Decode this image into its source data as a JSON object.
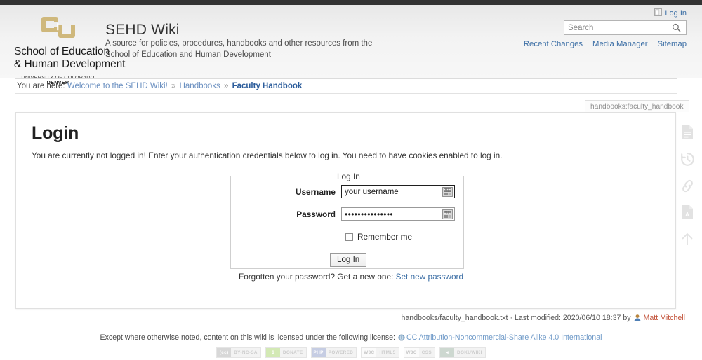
{
  "topbar": {
    "present": true,
    "color": "#333333"
  },
  "header": {
    "logo": {
      "mark_alt": "cu-monogram-icon",
      "name_line1": "School of Education",
      "name_line2": "& Human Development",
      "sub_prefix": "UNIVERSITY OF COLORADO ",
      "sub_bold": "DENVER",
      "gold": "#CFB87C"
    },
    "site_title": "SEHD Wiki",
    "tagline_line1": "A source for policies, procedures, handbooks and other resources from the",
    "tagline_line2": "School of Education and Human Development",
    "login_link": "Log In",
    "login_icon": "login-icon"
  },
  "search": {
    "placeholder": "Search",
    "value": "",
    "icon": "search-icon"
  },
  "toollinks": [
    {
      "label": "Recent Changes",
      "name": "recent-changes"
    },
    {
      "label": "Media Manager",
      "name": "media-manager"
    },
    {
      "label": "Sitemap",
      "name": "sitemap"
    }
  ],
  "breadcrumb": {
    "prefix": "You are here:",
    "items": [
      {
        "label": "Welcome to the SEHD Wiki!",
        "current": false
      },
      {
        "label": "Handbooks",
        "current": false
      },
      {
        "label": "Faculty Handbook",
        "current": true
      }
    ],
    "separator": "»"
  },
  "page_id_tab": "handbooks:faculty_handbook",
  "main": {
    "title": "Login",
    "intro": "You are currently not logged in! Enter your authentication credentials below to log in. You need to have cookies enabled to log in.",
    "form": {
      "legend": "Log In",
      "username_label": "Username",
      "username_value": "your username",
      "username_placeholder": "",
      "password_label": "Password",
      "password_value": "•••••••••••••••",
      "remember_label": "Remember me",
      "remember_checked": false,
      "submit_label": "Log In",
      "autofill_icon": "autofill-keyboard-icon"
    },
    "forgot_prefix": "Forgotten your password? Get a new one:",
    "forgot_link": "Set new password"
  },
  "icon_rail": [
    {
      "name": "show-page-source-icon",
      "glyph": "document"
    },
    {
      "name": "old-revisions-icon",
      "glyph": "history"
    },
    {
      "name": "backlinks-icon",
      "glyph": "link"
    },
    {
      "name": "export-pdf-icon",
      "glyph": "pdf"
    },
    {
      "name": "back-to-top-icon",
      "glyph": "arrow-up"
    }
  ],
  "docinfo": {
    "path": "handbooks/faculty_handbook.txt",
    "separator": "·",
    "modified_label": "Last modified: 2020/06/10 18:37 by",
    "user": "Matt Mitchell",
    "user_icon": "user-avatar-icon"
  },
  "license": {
    "text": "Except where otherwise noted, content on this wiki is licensed under the following license:",
    "icon": "globe-icon",
    "link": "CC Attribution-Noncommercial-Share Alike 4.0 International"
  },
  "badges": [
    {
      "name": "cc-badge",
      "left": "(cc)",
      "right": "BY-NC-SA",
      "left_bg": "#9a9a9a"
    },
    {
      "name": "donate-badge",
      "left": "$",
      "right": "DONATE",
      "left_bg": "#8dc63f"
    },
    {
      "name": "php-badge",
      "left": "PHP",
      "right": "POWERED",
      "left_bg": "#6c7eb7"
    },
    {
      "name": "html5-badge",
      "left": "W3C",
      "right": "HTML5",
      "left_bg": "#f5f5f5"
    },
    {
      "name": "css-badge",
      "left": "W3C",
      "right": "CSS",
      "left_bg": "#f5f5f5"
    },
    {
      "name": "dokuwiki-badge",
      "left": "◄",
      "right": "DOKUWIKI",
      "left_bg": "#7e9a86"
    }
  ]
}
